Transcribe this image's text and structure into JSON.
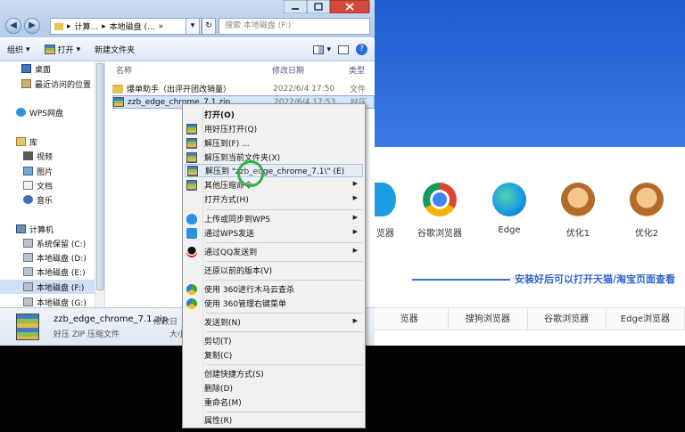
{
  "explorer": {
    "address_segments": [
      "计算...",
      "本地磁盘 (...",
      "»"
    ],
    "search_placeholder": "搜索 本地磁盘 (F:)",
    "toolbar": {
      "organize": "组织",
      "open": "打开",
      "new_folder": "新建文件夹"
    },
    "nav_items": [
      {
        "label": "桌面",
        "icon": "desktop-icon"
      },
      {
        "label": "最近访问的位置",
        "icon": "recent-places-icon"
      },
      {
        "label": "WPS网盘",
        "icon": "wps-cloud-icon"
      },
      {
        "label": "库",
        "icon": "library-icon"
      },
      {
        "label": "视频",
        "icon": "video-library-icon"
      },
      {
        "label": "图片",
        "icon": "picture-library-icon"
      },
      {
        "label": "文档",
        "icon": "document-library-icon"
      },
      {
        "label": "音乐",
        "icon": "music-library-icon"
      },
      {
        "label": "计算机",
        "icon": "computer-icon"
      },
      {
        "label": "系统保留 (C:)",
        "icon": "drive-icon"
      },
      {
        "label": "本地磁盘 (D:)",
        "icon": "drive-icon"
      },
      {
        "label": "本地磁盘 (E:)",
        "icon": "drive-icon"
      },
      {
        "label": "本地磁盘 (F:)",
        "icon": "drive-icon"
      },
      {
        "label": "本地磁盘 (G:)",
        "icon": "drive-icon"
      }
    ],
    "columns": {
      "name": "名称",
      "date": "修改日期",
      "type": "类型"
    },
    "files": [
      {
        "name": "爆单助手（出评开团改销量）",
        "date": "2022/6/4 17:50",
        "type": "文件",
        "icon": "folder-icon"
      },
      {
        "name": "zzb_edge_chrome_7.1.zip",
        "date": "2022/6/4 17:53",
        "type": "好压",
        "icon": "zip-icon"
      }
    ],
    "details": {
      "name": "zzb_edge_chrome_7.1.zip",
      "type": "好压 ZIP 压缩文件",
      "meta1": "修改日",
      "meta2": "大小"
    }
  },
  "context_menu": {
    "items": [
      {
        "label": "打开(O)",
        "icon": "",
        "bold": true,
        "submenu": false
      },
      {
        "label": "用好压打开(Q)",
        "icon": "haozip-icon",
        "bold": false,
        "submenu": false
      },
      {
        "label": "解压到(F) ...",
        "icon": "haozip-icon",
        "bold": false,
        "submenu": false
      },
      {
        "label": "解压到当前文件夹(X)",
        "icon": "haozip-icon",
        "bold": false,
        "submenu": false
      },
      {
        "label": "解压到 \"zzb_edge_chrome_7.1\\\" (E)",
        "icon": "haozip-icon",
        "bold": false,
        "submenu": false
      },
      {
        "label": "其他压缩命令",
        "icon": "haozip-icon",
        "bold": false,
        "submenu": true
      },
      {
        "label": "打开方式(H)",
        "icon": "",
        "bold": false,
        "submenu": true
      },
      {
        "label": "上传或同步到WPS",
        "icon": "wps-cloud-icon",
        "bold": false,
        "submenu": true
      },
      {
        "label": "通过WPS发送",
        "icon": "wps-icon",
        "bold": false,
        "submenu": true
      },
      {
        "label": "通过QQ发送到",
        "icon": "qq-icon",
        "bold": false,
        "submenu": true
      },
      {
        "label": "还原以前的版本(V)",
        "icon": "",
        "bold": false,
        "submenu": false
      },
      {
        "label": "使用 360进行木马云查杀",
        "icon": "360-icon",
        "bold": false,
        "submenu": false
      },
      {
        "label": "使用 360管理右键菜单",
        "icon": "360-icon",
        "bold": false,
        "submenu": false
      },
      {
        "label": "发送到(N)",
        "icon": "",
        "bold": false,
        "submenu": true
      },
      {
        "label": "剪切(T)",
        "icon": "",
        "bold": false,
        "submenu": false
      },
      {
        "label": "复制(C)",
        "icon": "",
        "bold": false,
        "submenu": false
      },
      {
        "label": "创建快捷方式(S)",
        "icon": "",
        "bold": false,
        "submenu": false
      },
      {
        "label": "删除(D)",
        "icon": "",
        "bold": false,
        "submenu": false
      },
      {
        "label": "重命名(M)",
        "icon": "",
        "bold": false,
        "submenu": false
      },
      {
        "label": "属性(R)",
        "icon": "",
        "bold": false,
        "submenu": false
      }
    ]
  },
  "background_page": {
    "apps": [
      {
        "label": "览器",
        "icon": "browser-icon"
      },
      {
        "label": "谷歌浏览器",
        "icon": "chrome-icon"
      },
      {
        "label": "Edge",
        "icon": "edge-icon"
      },
      {
        "label": "优化1",
        "icon": "monkey-mascot-icon"
      },
      {
        "label": "优化2",
        "icon": "monkey-mascot-icon"
      }
    ],
    "tagline": "安装好后可以打开天猫/淘宝页面查看",
    "browser_tabs": [
      "览器",
      "搜狗浏览器",
      "谷歌浏览器",
      "Edge浏览器"
    ]
  },
  "colors": {
    "header_blue": "#2f6bd9",
    "tagline_blue": "#2e64cf",
    "menu_bg": "#f1f1f1",
    "selection": "#d3e5fa"
  }
}
